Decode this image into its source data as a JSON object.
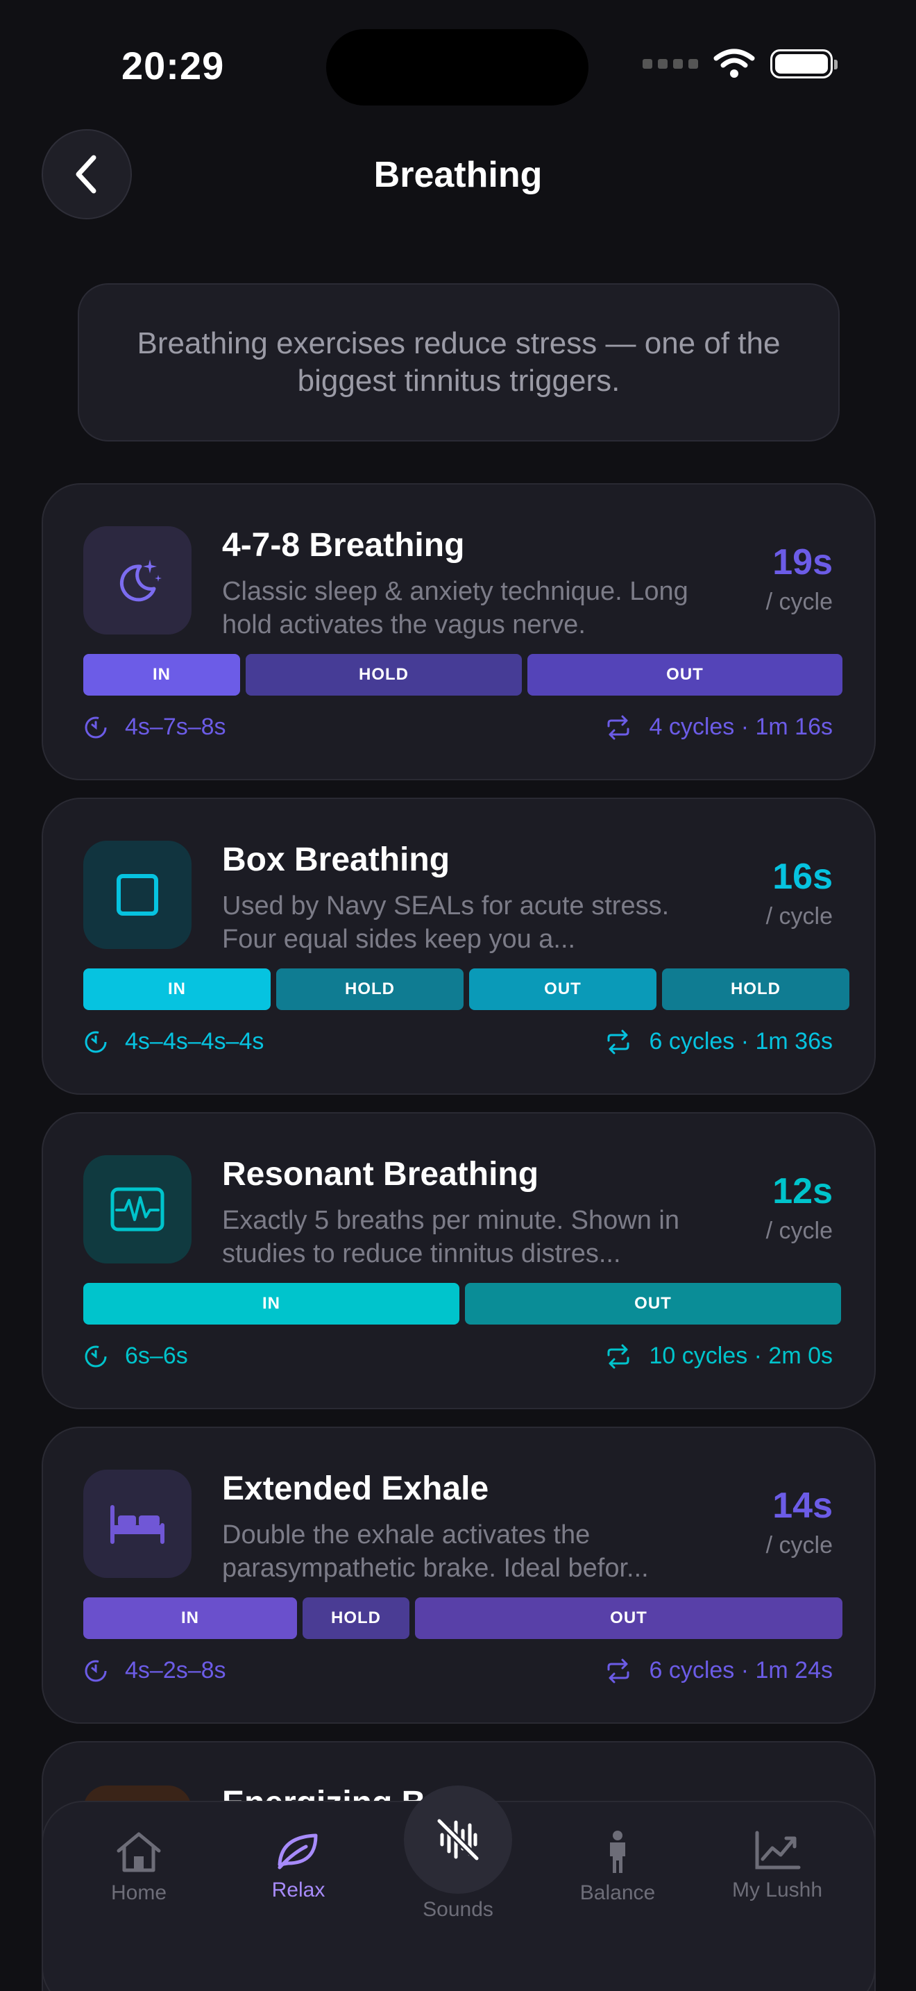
{
  "status": {
    "time": "20:29"
  },
  "header": {
    "title": "Breathing"
  },
  "banner": {
    "text": "Breathing exercises reduce stress — one of the biggest tinnitus triggers."
  },
  "colors": {
    "purple": "#6c5ce7",
    "cyan": "#06c3e0",
    "teal": "#00c4cc",
    "active_tab": "#a78bfa"
  },
  "cards": [
    {
      "title": "4-7-8 Breathing",
      "description": "Classic sleep & anxiety technique. Long hold activates the vagus nerve.",
      "duration": "19s",
      "duration_unit": "/ cycle",
      "icon": "moon-stars-icon",
      "phases": [
        {
          "label": "IN",
          "seconds": 4
        },
        {
          "label": "HOLD",
          "seconds": 7
        },
        {
          "label": "OUT",
          "seconds": 8
        }
      ],
      "pattern": "4s–7s–8s",
      "cycles": "4 cycles · 1m 16s"
    },
    {
      "title": "Box Breathing",
      "description": "Used by Navy SEALs for acute stress. Four equal sides keep you a...",
      "duration": "16s",
      "duration_unit": "/ cycle",
      "icon": "square-icon",
      "phases": [
        {
          "label": "IN",
          "seconds": 4
        },
        {
          "label": "HOLD",
          "seconds": 4
        },
        {
          "label": "OUT",
          "seconds": 4
        },
        {
          "label": "HOLD",
          "seconds": 4
        }
      ],
      "pattern": "4s–4s–4s–4s",
      "cycles": "6 cycles · 1m 36s"
    },
    {
      "title": "Resonant Breathing",
      "description": "Exactly 5 breaths per minute. Shown in studies to reduce tinnitus distres...",
      "duration": "12s",
      "duration_unit": "/ cycle",
      "icon": "waveform-monitor-icon",
      "phases": [
        {
          "label": "IN",
          "seconds": 6
        },
        {
          "label": "OUT",
          "seconds": 6
        }
      ],
      "pattern": "6s–6s",
      "cycles": "10 cycles · 2m 0s"
    },
    {
      "title": "Extended Exhale",
      "description": "Double the exhale activates the parasympathetic brake. Ideal befor...",
      "duration": "14s",
      "duration_unit": "/ cycle",
      "icon": "bed-icon",
      "phases": [
        {
          "label": "IN",
          "seconds": 4
        },
        {
          "label": "HOLD",
          "seconds": 2
        },
        {
          "label": "OUT",
          "seconds": 8
        }
      ],
      "pattern": "4s–2s–8s",
      "cycles": "6 cycles · 1m 24s"
    }
  ],
  "partial_card": {
    "title": "Energizing Br..."
  },
  "tabs": [
    {
      "label": "Home",
      "icon": "home-icon"
    },
    {
      "label": "Relax",
      "icon": "leaf-icon",
      "active": true
    },
    {
      "label": "Sounds",
      "icon": "sound-off-icon"
    },
    {
      "label": "Balance",
      "icon": "person-icon"
    },
    {
      "label": "My Lushh",
      "icon": "chart-up-icon"
    }
  ]
}
